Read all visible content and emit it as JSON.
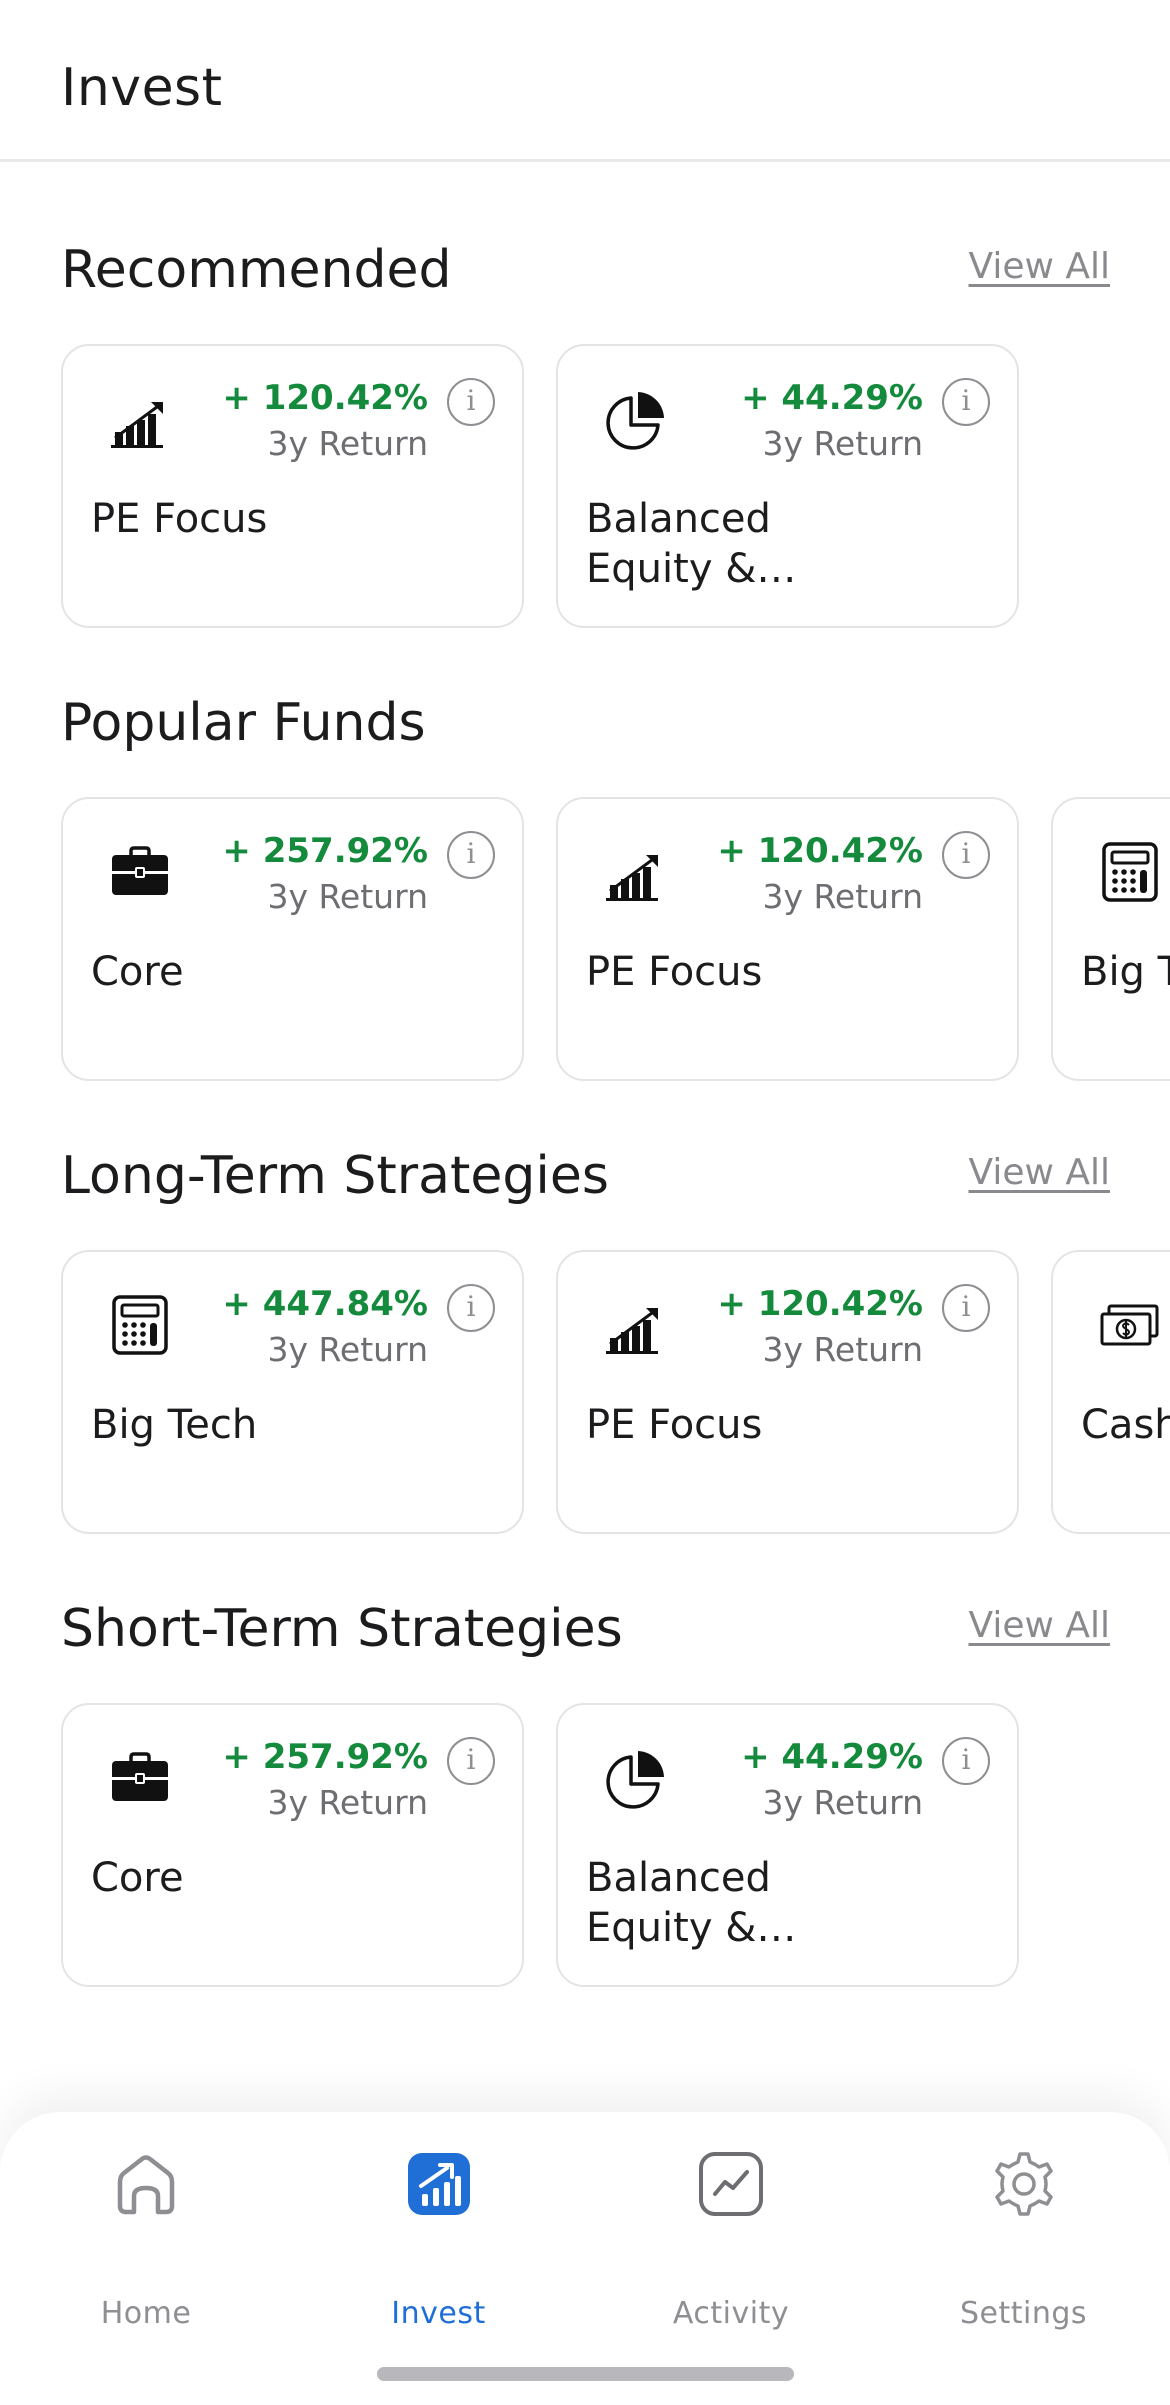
{
  "header": {
    "title": "Invest"
  },
  "sections": [
    {
      "title": "Recommended",
      "view_all": "View All",
      "cards": [
        {
          "icon": "bar-chart-icon",
          "return_pct": "+ 120.42%",
          "return_label": "3y Return",
          "name": "PE Focus"
        },
        {
          "icon": "pie-chart-icon",
          "return_pct": "+ 44.29%",
          "return_label": "3y Return",
          "name": "Balanced Equity & Income"
        }
      ]
    },
    {
      "title": "Popular Funds",
      "view_all": "",
      "cards": [
        {
          "icon": "briefcase-icon",
          "return_pct": "+ 257.92%",
          "return_label": "3y Return",
          "name": "Core"
        },
        {
          "icon": "bar-chart-icon",
          "return_pct": "+ 120.42%",
          "return_label": "3y Return",
          "name": "PE Focus"
        },
        {
          "icon": "calculator-icon",
          "return_pct": "",
          "return_label": "",
          "name": "Big Tech"
        }
      ]
    },
    {
      "title": "Long-Term Strategies",
      "view_all": "View All",
      "cards": [
        {
          "icon": "calculator-icon",
          "return_pct": "+ 447.84%",
          "return_label": "3y Return",
          "name": "Big Tech"
        },
        {
          "icon": "bar-chart-icon",
          "return_pct": "+ 120.42%",
          "return_label": "3y Return",
          "name": "PE Focus"
        },
        {
          "icon": "cash-icon",
          "return_pct": "",
          "return_label": "",
          "name": "Cash Focus"
        }
      ]
    },
    {
      "title": "Short-Term Strategies",
      "view_all": "View All",
      "cards": [
        {
          "icon": "briefcase-icon",
          "return_pct": "+ 257.92%",
          "return_label": "3y Return",
          "name": "Core"
        },
        {
          "icon": "pie-chart-icon",
          "return_pct": "+ 44.29%",
          "return_label": "3y Return",
          "name": "Balanced Equity & Income"
        }
      ]
    }
  ],
  "tabbar": {
    "tabs": [
      {
        "label": "Home",
        "icon": "home-icon",
        "active": false
      },
      {
        "label": "Invest",
        "icon": "invest-icon",
        "active": true
      },
      {
        "label": "Activity",
        "icon": "activity-icon",
        "active": false
      },
      {
        "label": "Settings",
        "icon": "gear-icon",
        "active": false
      }
    ]
  },
  "colors": {
    "positive": "#148a3c",
    "accent": "#1f6fd6",
    "muted": "#8e8e93"
  }
}
